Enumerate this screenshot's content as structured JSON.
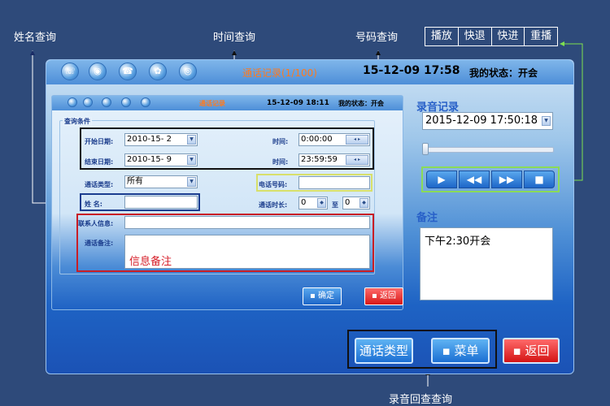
{
  "annotations": {
    "name_query": "姓名查询",
    "time_query": "时间查询",
    "number_query": "号码查询",
    "record_query": "录音回查查询",
    "info_note": "信息备注"
  },
  "control_legend": [
    "播放",
    "快退",
    "快进",
    "重播"
  ],
  "top_bar": {
    "title": "通话记录(1/100)",
    "time": "15-12-09 17:58",
    "status": "我的状态：开会"
  },
  "inner_bar": {
    "title": "通话记录",
    "time": "15-12-09 18:11",
    "status": "我的状态：开会"
  },
  "query": {
    "legend": "查询条件",
    "start_date_label": "开始日期:",
    "start_date_value": "2010-15-  2",
    "end_date_label": "结束日期:",
    "end_date_value": "2010-15-  9",
    "time_label": "时间:",
    "start_time_value": "0:00:00",
    "end_time_value": "23:59:59",
    "call_type_label": "通话类型:",
    "call_type_value": "所有",
    "phone_label": "电话号码:",
    "phone_value": "",
    "name_label": "姓    名:",
    "name_value": "",
    "duration_label": "通话时长:",
    "duration_from": "0",
    "duration_to_label": "至",
    "duration_to": "0",
    "contact_label": "联系人信息:",
    "contact_value": "",
    "note_label": "通话备注:",
    "note_value": "",
    "confirm_btn": "确定",
    "back_btn": "返回"
  },
  "right_panel": {
    "record_title": "录音记录",
    "datetime_value": "2015-12-09 17:50:18",
    "playback_buttons": [
      "▶",
      "◀◀",
      "▶▶",
      "■"
    ],
    "note_title": "备注",
    "note_text": "下午2:30开会"
  },
  "bottom_buttons": {
    "call_type": "通话类型",
    "menu": "菜单",
    "back": "返回"
  }
}
